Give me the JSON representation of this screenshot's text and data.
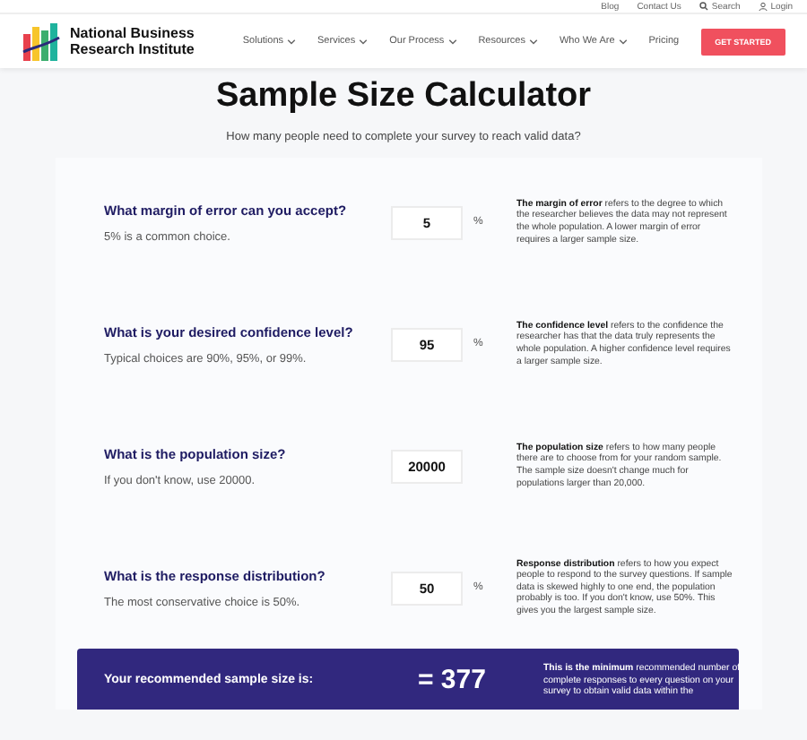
{
  "top_links": [
    {
      "label": "Blog",
      "kind": "text"
    },
    {
      "label": "Contact Us",
      "kind": "text"
    },
    {
      "label": "Search",
      "kind": "search"
    },
    {
      "label": "Login",
      "kind": "user"
    }
  ],
  "brand": {
    "line1": "National Business",
    "line2": "Research Institute"
  },
  "nav": [
    {
      "label": "Solutions",
      "dropdown": true
    },
    {
      "label": "Services",
      "dropdown": true
    },
    {
      "label": "Our Process",
      "dropdown": true
    },
    {
      "label": "Resources",
      "dropdown": true
    },
    {
      "label": "Who We Are",
      "dropdown": true
    },
    {
      "label": "Pricing",
      "dropdown": false
    }
  ],
  "cta": "GET STARTED",
  "title": "Sample Size Calculator",
  "subtitle": "How many people need to complete your survey to reach valid data?",
  "rows": [
    {
      "question": "What margin of error can you accept?",
      "hint": "5% is a common choice.",
      "value": "5",
      "unit": "%",
      "description": "**The margin of error** refers to the degree to which the researcher believes the data may not represent the whole population. A lower margin of error requires a larger sample size."
    },
    {
      "question": "What is your desired confidence level?",
      "hint": "Typical choices are 90%, 95%, or 99%.",
      "value": "95",
      "unit": "%",
      "description": "**The confidence level** refers to the confidence the researcher has that the data truly represents the whole population. A higher confidence level requires a larger sample size."
    },
    {
      "question": "What is the population size?",
      "hint": "If you don't know, use 20000.",
      "value": "20000",
      "description": "**The population size** refers to how many people there are to choose from for your random sample. The sample size doesn't change much for populations larger than 20,000."
    },
    {
      "question": "What is the response distribution?",
      "hint": "The most conservative choice is 50%.",
      "value": "50",
      "unit": "%",
      "description": "**Response distribution** refers to how you expect people to respond to the survey questions. If sample data is skewed highly to one end, the population probably is too. If you don't know, use 50%. This gives you the largest sample size."
    }
  ],
  "result": {
    "label": "Your recommended sample size is:",
    "value": "= 377",
    "description": "**This is the minimum** recommended number of complete responses to every question on your survey to obtain valid data within the"
  }
}
